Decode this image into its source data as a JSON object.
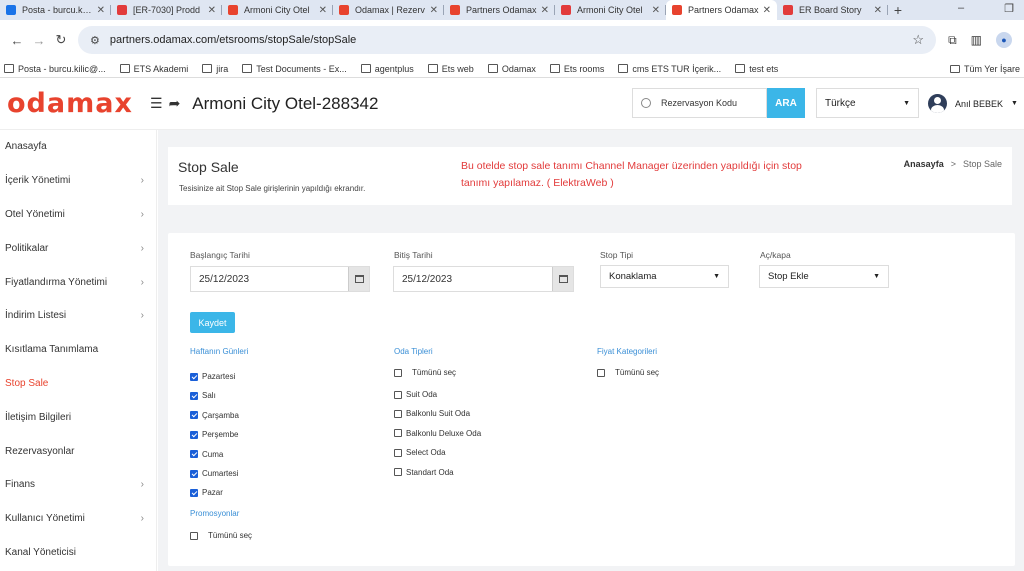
{
  "browser": {
    "tabs": [
      {
        "title": "Posta - burcu.kilic",
        "color": "#1a73e8",
        "active": false
      },
      {
        "title": "[ER-7030] Prodd",
        "color": "#e23b3b",
        "active": false
      },
      {
        "title": "Armoni City Otel",
        "color": "#e8432e",
        "active": false
      },
      {
        "title": "Odamax | Rezerv",
        "color": "#e8432e",
        "active": false
      },
      {
        "title": "Partners Odamax",
        "color": "#e8432e",
        "active": false
      },
      {
        "title": "Armoni City Otel",
        "color": "#e23b3b",
        "active": false
      },
      {
        "title": "Partners Odamax",
        "color": "#e8432e",
        "active": true
      },
      {
        "title": "ER Board Story",
        "color": "#e23b3b",
        "active": false
      }
    ],
    "url": "partners.odamax.com/etsrooms/stopSale/stopSale",
    "bookmarks": [
      "Posta - burcu.kilic@...",
      "ETS Akademi",
      "jira",
      "Test Documents - Ex...",
      "agentplus",
      "Ets web",
      "Odamax",
      "Ets rooms",
      "cms ETS TUR İçerik...",
      "test ets"
    ],
    "bookmarks_right": "Tüm Yer İşare"
  },
  "header": {
    "logo": "odamax",
    "hotel_name": "Armoni City Otel-288342",
    "search_placeholder": "Rezervasyon Kodu",
    "search_button": "ARA",
    "language": "Türkçe",
    "user_name": "Anıl BEBEK"
  },
  "sidebar": {
    "items": [
      {
        "label": "Anasayfa",
        "chevron": false,
        "active": false
      },
      {
        "label": "İçerik Yönetimi",
        "chevron": true,
        "active": false
      },
      {
        "label": "Otel Yönetimi",
        "chevron": true,
        "active": false
      },
      {
        "label": "Politikalar",
        "chevron": true,
        "active": false
      },
      {
        "label": "Fiyatlandırma Yönetimi",
        "chevron": true,
        "active": false
      },
      {
        "label": "İndirim Listesi",
        "chevron": true,
        "active": false
      },
      {
        "label": "Kısıtlama Tanımlama",
        "chevron": false,
        "active": false
      },
      {
        "label": "Stop Sale",
        "chevron": false,
        "active": true
      },
      {
        "label": "İletişim Bilgileri",
        "chevron": false,
        "active": false
      },
      {
        "label": "Rezervasyonlar",
        "chevron": false,
        "active": false
      },
      {
        "label": "Finans",
        "chevron": true,
        "active": false
      },
      {
        "label": "Kullanıcı Yönetimi",
        "chevron": true,
        "active": false
      },
      {
        "label": "Kanal Yöneticisi",
        "chevron": false,
        "active": false
      }
    ]
  },
  "page": {
    "title": "Stop Sale",
    "subtitle": "Tesisinize ait Stop Sale girişlerinin yapıldığı ekrandır.",
    "warning": "Bu otelde stop sale tanımı Channel Manager üzerinden yapıldığı için stop tanımı yapılamaz. ( ElektraWeb )",
    "breadcrumb_home": "Anasayfa",
    "breadcrumb_sep": ">",
    "breadcrumb_current": "Stop Sale"
  },
  "form": {
    "start_label": "Başlangıç Tarihi",
    "start_value": "25/12/2023",
    "end_label": "Bitiş Tarihi",
    "end_value": "25/12/2023",
    "stop_type_label": "Stop Tipi",
    "stop_type_value": "Konaklama",
    "toggle_label": "Aç/kapa",
    "toggle_value": "Stop Ekle",
    "save_label": "Kaydet",
    "days_header": "Haftanın Günleri",
    "days": [
      {
        "label": "Pazartesi",
        "checked": true
      },
      {
        "label": "Salı",
        "checked": true
      },
      {
        "label": "Çarşamba",
        "checked": true
      },
      {
        "label": "Perşembe",
        "checked": true
      },
      {
        "label": "Cuma",
        "checked": true
      },
      {
        "label": "Cumartesi",
        "checked": true
      },
      {
        "label": "Pazar",
        "checked": true
      }
    ],
    "promo_header": "Promosyonlar",
    "promo_all": "Tümünü seç",
    "rooms_header": "Oda Tipleri",
    "rooms_all": "Tümünü seç",
    "rooms": [
      "Suit Oda",
      "Balkonlu Suit Oda",
      "Balkonlu Deluxe Oda",
      "Select Oda",
      "Standart Oda"
    ],
    "price_header": "Fiyat Kategorileri",
    "price_all": "Tümünü seç"
  }
}
